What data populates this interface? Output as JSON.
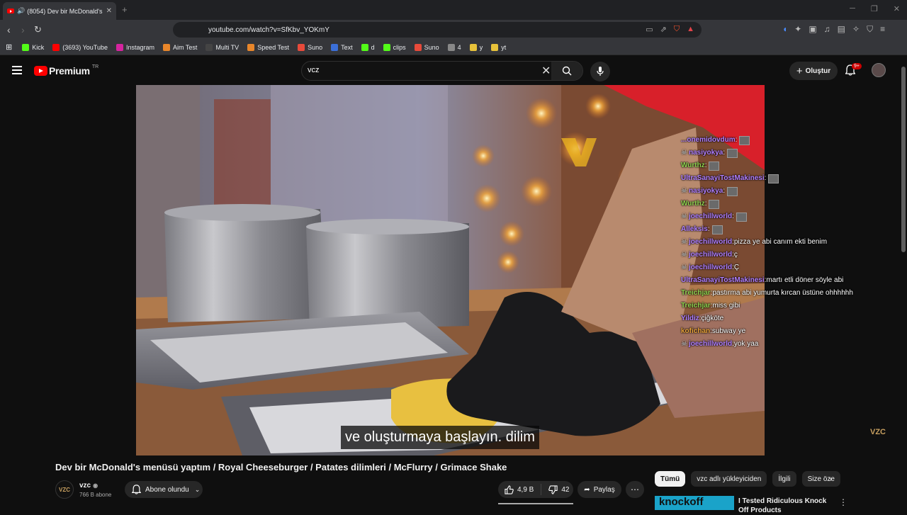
{
  "browser": {
    "tab_title": "(8054) Dev bir McDonald's m",
    "url": "youtube.com/watch?v=SfKbv_YOKmY",
    "bookmarks": [
      {
        "label": "Kick",
        "color": "#53fc18"
      },
      {
        "label": "(3693) YouTube",
        "color": "#ff0000"
      },
      {
        "label": "Instagram",
        "color": "#d6249f"
      },
      {
        "label": "Aim Test",
        "color": "#e8862a"
      },
      {
        "label": "Multi TV",
        "color": "#444444"
      },
      {
        "label": "Speed Test",
        "color": "#e8862a"
      },
      {
        "label": "Suno",
        "color": "#e84a3a"
      },
      {
        "label": "Text",
        "color": "#3b6fd8"
      },
      {
        "label": "d",
        "color": "#53fc18"
      },
      {
        "label": "clips",
        "color": "#53fc18"
      },
      {
        "label": "Suno",
        "color": "#e84a3a"
      },
      {
        "label": "4",
        "color": "#888888"
      },
      {
        "label": "y",
        "color": "#e8c23a"
      },
      {
        "label": "yt",
        "color": "#e8c23a"
      }
    ]
  },
  "yt": {
    "logo_text": "Premium",
    "region": "TR",
    "search_value": "vcz",
    "create_label": "Oluştur",
    "notif_badge": "9+"
  },
  "video": {
    "subtitle": "ve oluşturmaya başlayın. dilim",
    "watermark": "VZC",
    "chat": [
      {
        "user": "...onemidovdum",
        "user_color": "#b07fff",
        "text": "",
        "emote": true
      },
      {
        "user": "nasiyokya",
        "user_color": "#b07fff",
        "text": "",
        "emote": true,
        "skull": true
      },
      {
        "user": "Wurthz",
        "user_color": "#8fd14f",
        "text": "",
        "emote": true
      },
      {
        "user": "UltraSanayiTostMakinesi",
        "user_color": "#b07fff",
        "text": "",
        "emote": true
      },
      {
        "user": "nasiyokya",
        "user_color": "#b07fff",
        "text": "",
        "emote": true,
        "skull": true
      },
      {
        "user": "Wurthz",
        "user_color": "#8fd14f",
        "text": "",
        "emote": true
      },
      {
        "user": "joechillworld",
        "user_color": "#b07fff",
        "text": "",
        "emote": true,
        "skull": true
      },
      {
        "user": "Alleksis",
        "user_color": "#b07fff",
        "text": "",
        "emote": true
      },
      {
        "user": "joechillworld",
        "user_color": "#b07fff",
        "text": "pizza ye abi canım ekti benim",
        "skull": true
      },
      {
        "user": "joechillworld",
        "user_color": "#b07fff",
        "text": "ç",
        "skull": true
      },
      {
        "user": "joechillworld",
        "user_color": "#b07fff",
        "text": "Ç",
        "skull": true
      },
      {
        "user": "UltraSanayiTostMakinesi",
        "user_color": "#b07fff",
        "text": "martı etli döner söyle abi"
      },
      {
        "user": "Treichjar",
        "user_color": "#8fd14f",
        "text": "pastırma abi yumurta kırcan üstüne ohhhhhh"
      },
      {
        "user": "Treichjar",
        "user_color": "#8fd14f",
        "text": "miss gibi"
      },
      {
        "user": "Yildiz",
        "user_color": "#b07fff",
        "text": "çiğköte"
      },
      {
        "user": "kofichan",
        "user_color": "#e8a23a",
        "text": "subway ye"
      },
      {
        "user": "joechillworld",
        "user_color": "#b07fff",
        "text": "yok yaa",
        "skull": true
      }
    ]
  },
  "meta": {
    "title": "Dev bir McDonald's menüsü yaptım / Royal Cheeseburger / Patates dilimleri / McFlurry / Grimace Shake",
    "channel": "vzc",
    "channel_avatar": "VZC",
    "subs": "766 B abone",
    "subscribe_label": "Abone olundu",
    "likes": "4,9 B",
    "dislikes": "42",
    "share_label": "Paylaş"
  },
  "sidebar": {
    "chips": [
      "Tümü",
      "vzc adlı yükleyiciden",
      "İlgili",
      "Size öze"
    ],
    "rec_thumb_text": "knockoff",
    "rec_title": "I Tested Ridiculous Knock Off Products"
  }
}
